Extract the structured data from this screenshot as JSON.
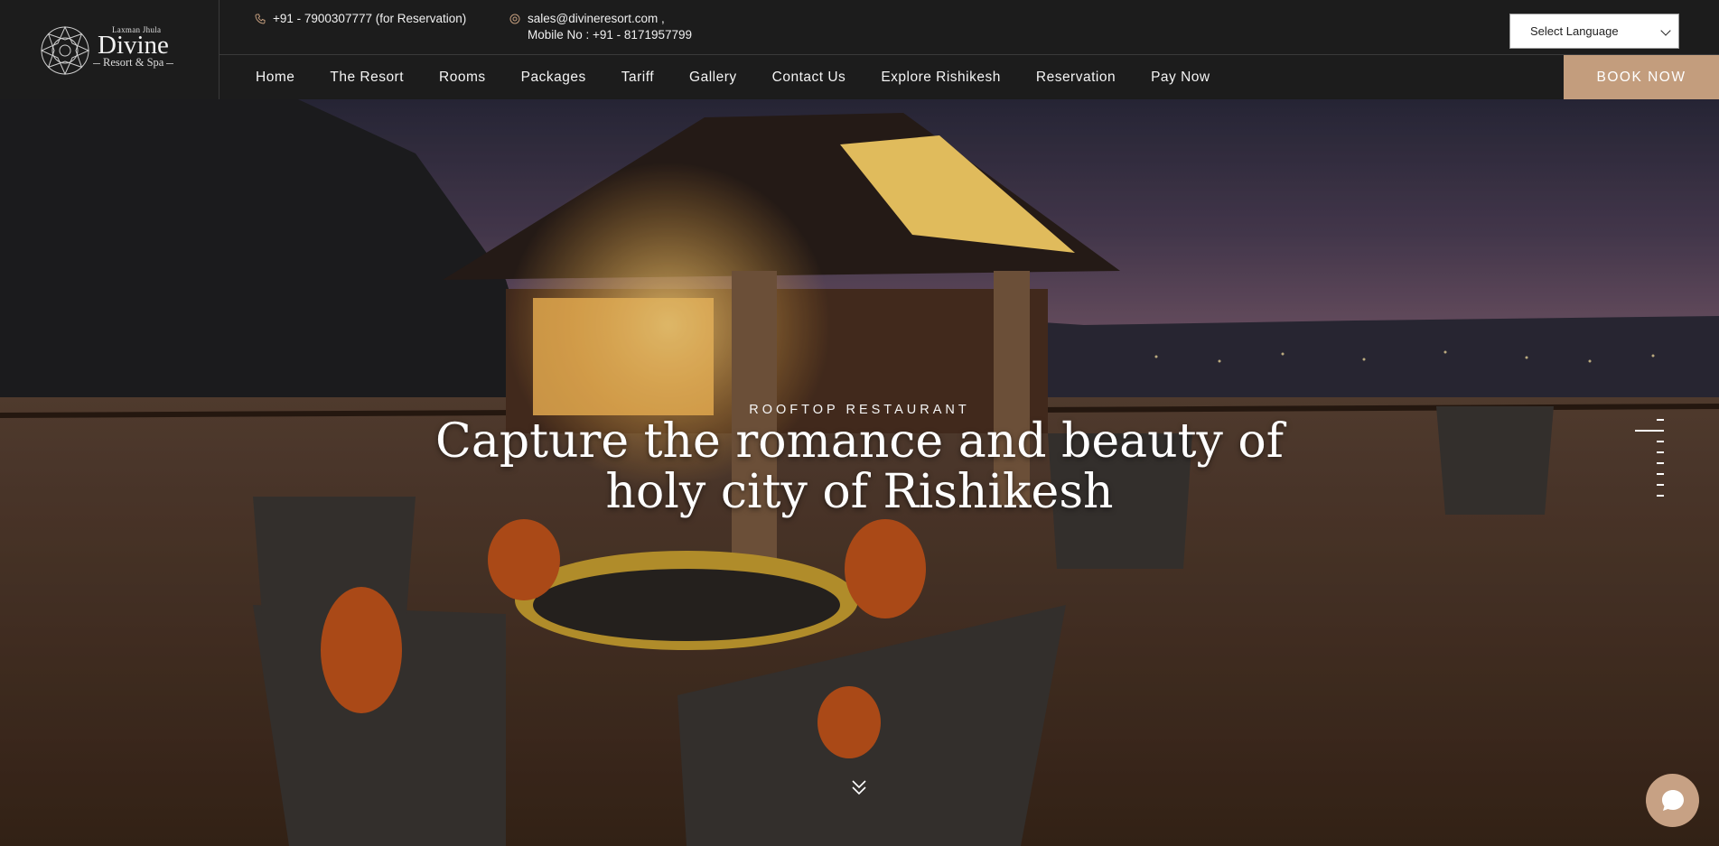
{
  "logo": {
    "small_text": "Laxman Jhula",
    "name": "Divine",
    "sub_text": "Resort & Spa"
  },
  "contact": {
    "phone": "+91 - 7900307777 (for Reservation)",
    "email": "sales@divineresort.com ,",
    "mobile": "Mobile No : +91 - 8171957799"
  },
  "language_select": {
    "selected": "Select Language"
  },
  "nav": {
    "items": [
      "Home",
      "The Resort",
      "Rooms",
      "Packages",
      "Tariff",
      "Gallery",
      "Contact Us",
      "Explore Rishikesh",
      "Reservation",
      "Pay Now"
    ],
    "book_now": "BOOK NOW"
  },
  "hero": {
    "eyebrow": "ROOFTOP RESTAURANT",
    "headline": "Capture the romance and beauty of holy city of Rishikesh"
  },
  "colors": {
    "header_bg": "#1c1c1c",
    "accent": "#c39d7d"
  },
  "icons": [
    "phone-icon",
    "email-icon",
    "logo-mandala-icon",
    "scroll-down-icon",
    "chat-icon"
  ]
}
